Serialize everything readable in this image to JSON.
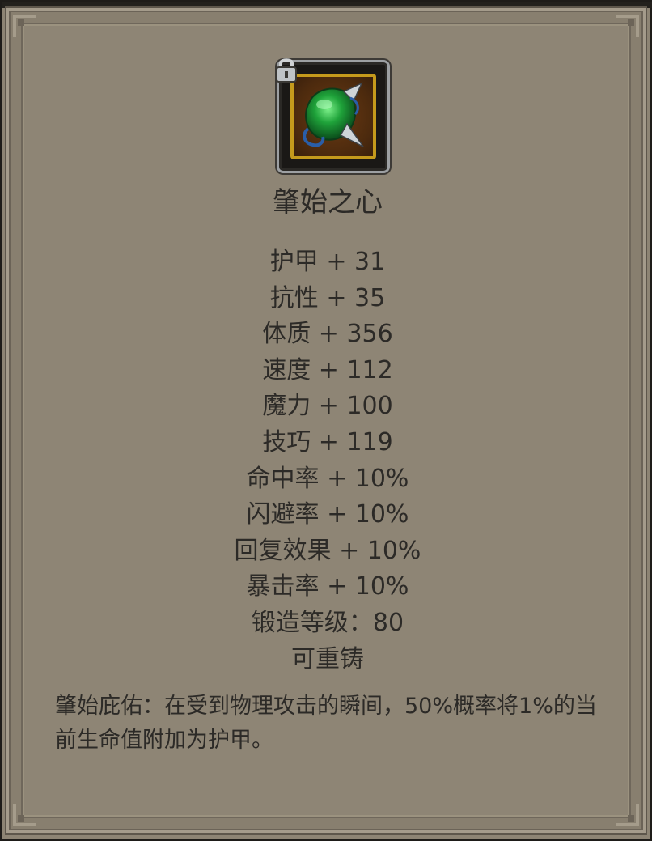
{
  "item": {
    "name": "肇始之心",
    "icon": "green-crystal-gem-icon",
    "locked_icon": "lock-icon",
    "colors": {
      "panel": "#8d8474",
      "icon_border_gold": "#c59a1c",
      "gem_green": "#1fa33a",
      "text": "#2c2a27"
    }
  },
  "stats": [
    "护甲 + 31",
    "抗性 + 35",
    "体质 + 356",
    "速度 + 112",
    "魔力 + 100",
    "技巧 + 119",
    "命中率 + 10%",
    "闪避率 + 10%",
    "回复效果 + 10%",
    "暴击率 + 10%",
    "锻造等级：80",
    "可重铸"
  ],
  "description": "肇始庇佑：在受到物理攻击的瞬间，50%概率将1%的当前生命值附加为护甲。"
}
